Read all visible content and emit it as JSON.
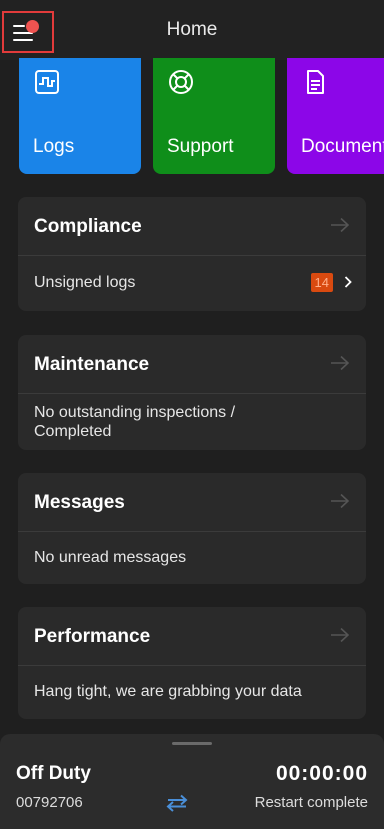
{
  "header": {
    "title": "Home"
  },
  "tiles": [
    {
      "label": "Logs",
      "icon": "logs-icon",
      "color": "#1a84e8"
    },
    {
      "label": "Support",
      "icon": "lifebuoy-icon",
      "color": "#0f8e1a"
    },
    {
      "label": "Document",
      "icon": "document-icon",
      "color": "#8c06e8"
    }
  ],
  "compliance": {
    "title": "Compliance",
    "row_label": "Unsigned logs",
    "badge": "14"
  },
  "maintenance": {
    "title": "Maintenance",
    "status": "No outstanding inspections / Completed"
  },
  "messages": {
    "title": "Messages",
    "status": "No unread messages"
  },
  "performance": {
    "title": "Performance",
    "status": "Hang tight, we are grabbing your data"
  },
  "bottom_bar": {
    "duty_status": "Off Duty",
    "driver_id": "00792706",
    "timer": "00:00:00",
    "restart_status": "Restart complete"
  }
}
